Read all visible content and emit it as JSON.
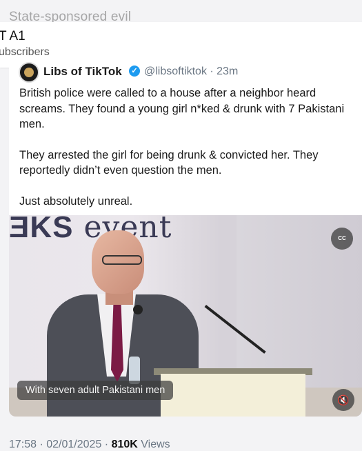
{
  "background_title": "State-sponsored evil",
  "channel": {
    "name": "T A1",
    "subscribers": "ubscribers"
  },
  "tweet": {
    "author": "Libs of TikTok",
    "verified_icon": "verified-badge-icon",
    "handle_time": "@libsoftiktok · 23m",
    "paragraphs": [
      "British police were called to a house after a neighbor heard screams. They found a young girl n*ked & drunk with 7 Pakistani men.",
      "They arrested the girl for being drunk & convicted her. They reportedly didn’t even question the men.",
      "Just absolutely unreal."
    ]
  },
  "video": {
    "sign_text": "event",
    "sign_prefix": "ƎKS",
    "cc_label": "CC",
    "caption": "With seven adult Pakistani men",
    "mute_icon": "speaker-muted-icon"
  },
  "meta": {
    "timestamp": "17:58 · 02/01/2025 · ",
    "views_count": "810K",
    "views_label": " Views"
  },
  "colors": {
    "verified_blue": "#1d9bf0",
    "secondary_text": "#6b7784",
    "tie": "#7b1b45"
  }
}
